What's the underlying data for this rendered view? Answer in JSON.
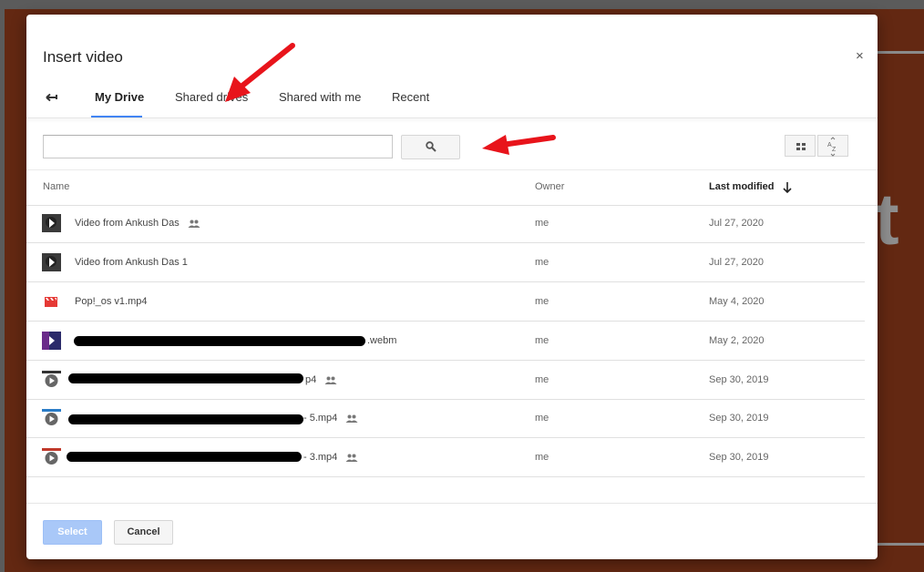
{
  "dialog": {
    "title": "Insert video",
    "close_label": "×"
  },
  "tabs": [
    {
      "label": "My Drive",
      "active": true
    },
    {
      "label": "Shared drives",
      "active": false
    },
    {
      "label": "Shared with me",
      "active": false
    },
    {
      "label": "Recent",
      "active": false
    }
  ],
  "search": {
    "value": "",
    "placeholder": ""
  },
  "columns": {
    "name": "Name",
    "owner": "Owner",
    "last_modified": "Last modified"
  },
  "files": [
    {
      "name": "Video from Ankush Das",
      "shared": true,
      "owner": "me",
      "modified": "Jul 27, 2020",
      "thumb": "video-thumbnail"
    },
    {
      "name": "Video from Ankush Das 1",
      "shared": false,
      "owner": "me",
      "modified": "Jul 27, 2020",
      "thumb": "video-thumbnail"
    },
    {
      "name": "Pop!_os v1.mp4",
      "shared": false,
      "owner": "me",
      "modified": "May 4, 2020",
      "thumb": "red-video-file-icon"
    },
    {
      "name": ".webm",
      "shared": false,
      "owner": "me",
      "modified": "May 2, 2020",
      "thumb": "video-thumbnail"
    },
    {
      "name": "p4",
      "shared": true,
      "owner": "me",
      "modified": "Sep 30, 2019",
      "thumb": "video-thumbnail"
    },
    {
      "name": "- 5.mp4",
      "shared": true,
      "owner": "me",
      "modified": "Sep 30, 2019",
      "thumb": "video-thumbnail"
    },
    {
      "name": "- 3.mp4",
      "shared": true,
      "owner": "me",
      "modified": "Sep 30, 2019",
      "thumb": "video-thumbnail"
    }
  ],
  "footer": {
    "select_label": "Select",
    "cancel_label": "Cancel"
  },
  "colors": {
    "accent": "#4285f4",
    "annotation_arrow": "#e8141b",
    "slide_background": "#632812"
  },
  "background_text": "t"
}
